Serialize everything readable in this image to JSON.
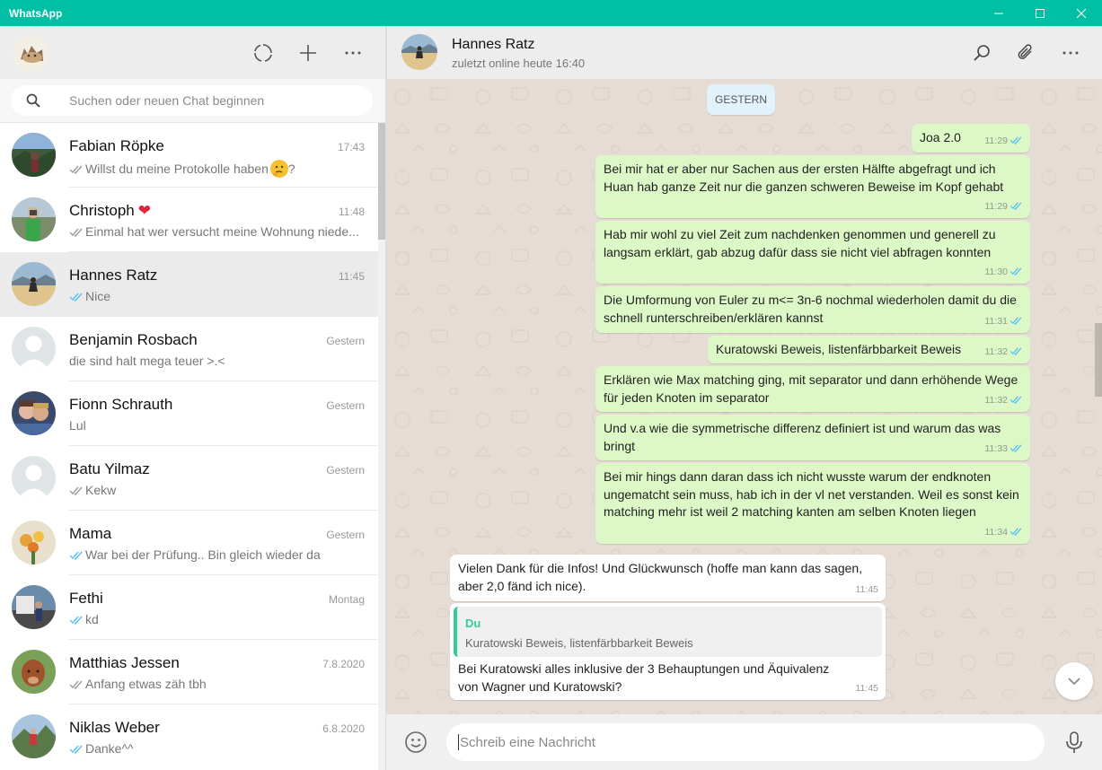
{
  "window": {
    "title": "WhatsApp",
    "accent": "#00bfa5"
  },
  "sidebar": {
    "search_placeholder": "Suchen oder neuen Chat beginnen",
    "chats": [
      {
        "name": "Fabian Röpke",
        "time": "17:43",
        "preview": "Willst du meine Protokolle haben",
        "suffix": "?",
        "tick": "grey",
        "emoji": "thinking-face"
      },
      {
        "name": "Christoph",
        "time": "11:48",
        "preview": "Einmal hat wer versucht meine Wohnung niede...",
        "tick": "grey",
        "name_emoji": "red-heart"
      },
      {
        "name": "Hannes Ratz",
        "time": "11:45",
        "preview": "Nice",
        "tick": "blue",
        "active": true
      },
      {
        "name": "Benjamin Rosbach",
        "time": "Gestern",
        "preview": "die sind halt mega teuer >.<",
        "tick": "none"
      },
      {
        "name": "Fionn Schrauth",
        "time": "Gestern",
        "preview": "Lul",
        "tick": "none"
      },
      {
        "name": "Batu Yilmaz",
        "time": "Gestern",
        "preview": "Kekw",
        "tick": "grey"
      },
      {
        "name": "Mama",
        "time": "Gestern",
        "preview": "War bei der Prüfung.. Bin gleich wieder da",
        "tick": "blue"
      },
      {
        "name": "Fethi",
        "time": "Montag",
        "preview": "kd",
        "tick": "blue"
      },
      {
        "name": "Matthias Jessen",
        "time": "7.8.2020",
        "preview": "Anfang etwas zäh tbh",
        "tick": "grey"
      },
      {
        "name": "Niklas Weber",
        "time": "6.8.2020",
        "preview": "Danke^^",
        "tick": "blue"
      }
    ]
  },
  "conversation": {
    "name": "Hannes Ratz",
    "status": "zuletzt online heute 16:40",
    "date_chip": "GESTERN",
    "messages": [
      {
        "dir": "out",
        "text": "Joa 2.0",
        "time": "11:29"
      },
      {
        "dir": "out",
        "text": "Bei mir hat er aber nur Sachen aus der ersten Hälfte abgefragt und ich Huan hab ganze Zeit nur die ganzen schweren Beweise im Kopf gehabt",
        "time": "11:29"
      },
      {
        "dir": "out",
        "text": "Hab mir wohl zu viel Zeit zum nachdenken genommen und generell zu langsam erklärt, gab abzug dafür dass sie nicht viel abfragen konnten",
        "time": "11:30"
      },
      {
        "dir": "out",
        "text": "Die Umformung von Euler zu m<= 3n-6 nochmal wiederholen damit du die schnell runterschreiben/erklären  kannst",
        "time": "11:31"
      },
      {
        "dir": "out",
        "text": "Kuratowski Beweis, listenfärbbarkeit Beweis",
        "time": "11:32"
      },
      {
        "dir": "out",
        "text": "Erklären wie Max matching ging, mit separator und dann erhöhende Wege für jeden Knoten im separator",
        "time": "11:32"
      },
      {
        "dir": "out",
        "text": "Und v.a wie die symmetrische differenz definiert ist und warum das was bringt",
        "time": "11:33"
      },
      {
        "dir": "out",
        "text": "Bei mir hings dann daran dass ich nicht wusste warum der endknoten ungematcht sein muss, hab ich in der vl net verstanden. Weil es sonst kein matching mehr ist weil 2 matching kanten am selben Knoten liegen",
        "time": "11:34"
      },
      {
        "dir": "in",
        "text": "Vielen Dank für die Infos! Und Glückwunsch (hoffe man kann das sagen, aber 2,0 fänd ich nice).",
        "time": "11:45"
      },
      {
        "dir": "in",
        "quote_name": "Du",
        "quote_text": "Kuratowski Beweis, listenfärbbarkeit Beweis",
        "text": "Bei Kuratowski alles inklusive der 3 Behauptungen und Äquivalenz von Wagner und Kuratowski?",
        "time": "11:45"
      }
    ]
  },
  "composer": {
    "placeholder": "Schreib eine Nachricht"
  },
  "colors": {
    "out_bubble": "#dcf8c6",
    "in_bubble": "#ffffff",
    "tick_blue": "#4fc3f7",
    "wallpaper": "#e5ddd5"
  }
}
